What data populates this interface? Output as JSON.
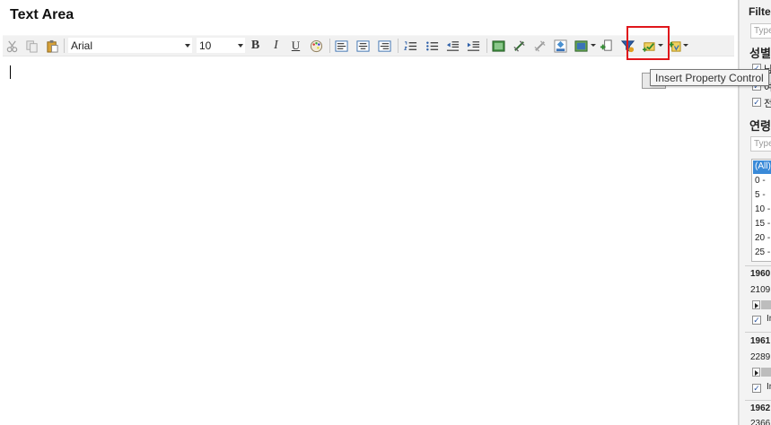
{
  "editor": {
    "title": "Text Area",
    "font_name": "Arial",
    "font_size": "10",
    "tooltip": "Insert Property Control"
  },
  "toolbar": {
    "icons": [
      "cut-icon",
      "copy-icon",
      "paste-icon",
      "bold-icon",
      "italic-icon",
      "underline-icon",
      "color-palette-icon",
      "align-left-icon",
      "align-center-icon",
      "align-right-icon",
      "numbered-list-icon",
      "bulleted-list-icon",
      "decrease-indent-icon",
      "increase-indent-icon",
      "insert-image-icon",
      "insert-link-icon",
      "remove-link-icon",
      "fill-color-icon",
      "table-icon",
      "insert-field-icon",
      "filter-icon",
      "insert-property-control-icon",
      "insert-dynamic-item-icon"
    ],
    "bold_glyph": "B",
    "italic_glyph": "I",
    "underline_glyph": "U"
  },
  "filter_panel": {
    "header": "Filter",
    "search_placeholder": "Type",
    "gender_label": "성별",
    "gender_items": [
      {
        "label": "남",
        "checked": true
      },
      {
        "label": "여",
        "checked": true
      },
      {
        "label": "전",
        "checked": true
      }
    ],
    "age_label": "연령",
    "age_search_placeholder": "Type",
    "age_options": [
      "(All)",
      "0 -",
      "5 -",
      "10 -",
      "15 -",
      "20 -",
      "25 -"
    ],
    "year_blocks": [
      {
        "year": "1960",
        "value": "2109",
        "include_label": "In"
      },
      {
        "year": "1961",
        "value": "2289",
        "include_label": "In"
      },
      {
        "year": "1962",
        "value": "2366"
      }
    ]
  },
  "colors": {
    "highlight": "#e0161b",
    "list_selected": "#3a8ad8",
    "checkbox_mark": "#2a55a0"
  }
}
